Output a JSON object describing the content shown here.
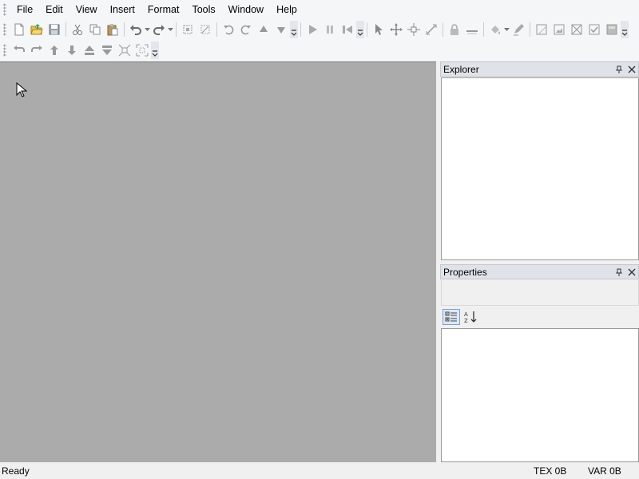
{
  "menubar": {
    "items": [
      "File",
      "Edit",
      "View",
      "Insert",
      "Format",
      "Tools",
      "Window",
      "Help"
    ]
  },
  "explorer": {
    "title": "Explorer"
  },
  "properties": {
    "title": "Properties"
  },
  "statusbar": {
    "status": "Ready",
    "tex": "TEX 0B",
    "var": "VAR 0B"
  }
}
